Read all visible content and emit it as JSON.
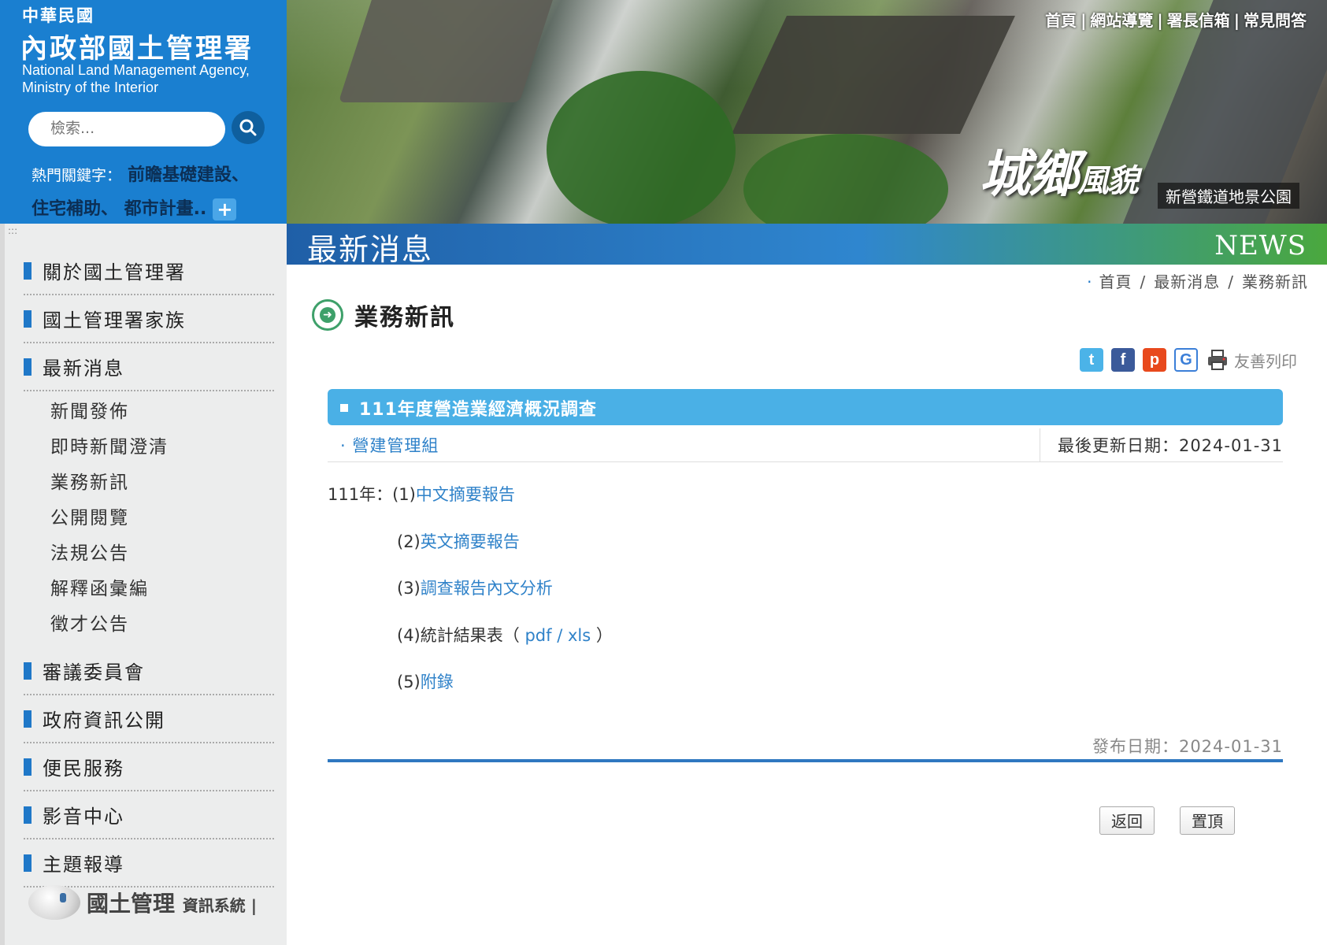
{
  "brand": {
    "roc": "中華民國",
    "agency_zh": "內政部國土管理署",
    "agency_en_line1": "National Land Management Agency,",
    "agency_en_line2": "Ministry of the Interior"
  },
  "search": {
    "placeholder": "檢索..."
  },
  "hot_keywords": {
    "label": "熱門關鍵字：",
    "kw1": "前瞻基礎建設、",
    "line2": "住宅補助、 都市計畫..",
    "more": "+"
  },
  "top_nav": {
    "home": "首頁",
    "sitemap": "網站導覽",
    "mailbox": "署長信箱",
    "faq": "常見問答",
    "sep": "|"
  },
  "banner": {
    "calligraphy_big": "城鄉",
    "calligraphy_small": "風貌",
    "caption": "新營鐵道地景公園"
  },
  "sidebar": {
    "items": [
      {
        "label": "關於國土管理署"
      },
      {
        "label": "國土管理署家族"
      },
      {
        "label": "最新消息"
      },
      {
        "label": "審議委員會"
      },
      {
        "label": "政府資訊公開"
      },
      {
        "label": "便民服務"
      },
      {
        "label": "影音中心"
      },
      {
        "label": "主題報導"
      }
    ],
    "news_sub": [
      "新聞發佈",
      "即時新聞澄清",
      "業務新訊",
      "公開閱覽",
      "法規公告",
      "解釋函彙編",
      "徵才公告"
    ],
    "sys_logo": {
      "main": "國土管理",
      "small": "資訊系統 |"
    }
  },
  "titlebar": {
    "zh": "最新消息",
    "en": "NEWS"
  },
  "breadcrumb": {
    "home": "首頁",
    "news": "最新消息",
    "current": "業務新訊",
    "sep": "/"
  },
  "section": {
    "title": "業務新訊"
  },
  "share": {
    "print_label": "友善列印",
    "twitter": "t",
    "facebook": "f",
    "plurk": "p",
    "google": "G"
  },
  "article": {
    "title": "111年度營造業經濟概況調查",
    "unit": "營建管理組",
    "updated_label": "最後更新日期：2024-01-31",
    "lines": {
      "l1_prefix": "111年：(1)",
      "l1_link": "中文摘要報告",
      "l2_prefix": "(2)",
      "l2_link": "英文摘要報告",
      "l3_prefix": "(3)",
      "l3_link": "調查報告內文分析",
      "l4_prefix": "(4)統計結果表（",
      "l4_pdf": "pdf",
      "l4_sep": "/",
      "l4_xls": "xls",
      "l4_suffix": "）",
      "l5_prefix": "(5)",
      "l5_link": "附錄"
    },
    "publish_label": "發布日期：2024-01-31"
  },
  "buttons": {
    "back": "返回",
    "top": "置頂"
  }
}
